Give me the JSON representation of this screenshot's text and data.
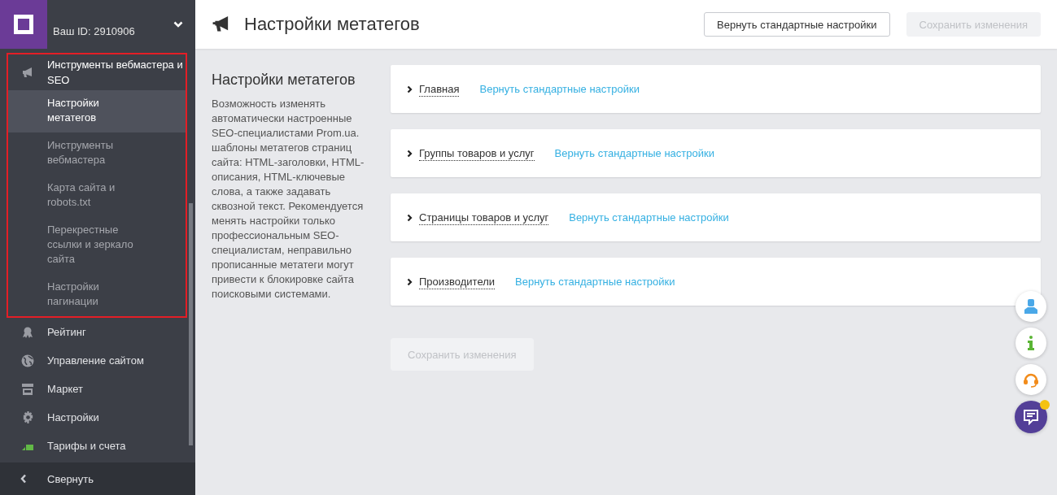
{
  "sidebar": {
    "account_id": "Ваш ID: 2910906",
    "menu": [
      {
        "label": "Инструменты вебмастера и SEO",
        "highlighted": true,
        "expanded": true,
        "children": [
          {
            "label": "Настройки метатегов",
            "selected": true
          },
          {
            "label": "Инструменты вебмастера",
            "selected": false
          },
          {
            "label": "Карта сайта и robots.txt",
            "selected": false
          },
          {
            "label": "Перекрестные ссылки и зеркало сайта",
            "selected": false
          },
          {
            "label": "Настройки пагинации",
            "selected": false
          }
        ]
      },
      {
        "label": "Рейтинг",
        "highlighted": false,
        "expanded": false
      },
      {
        "label": "Управление сайтом",
        "highlighted": false,
        "expanded": false
      },
      {
        "label": "Маркет",
        "highlighted": false,
        "expanded": false
      },
      {
        "label": "Настройки",
        "highlighted": false,
        "expanded": false
      },
      {
        "label": "Тарифы и счета",
        "highlighted": false,
        "expanded": false
      }
    ],
    "collapse": "Свернуть"
  },
  "header": {
    "title": "Настройки метатегов",
    "buttons": [
      {
        "label": "Вернуть стандартные настройки",
        "disabled": false
      },
      {
        "label": "Сохранить изменения",
        "disabled": true
      }
    ]
  },
  "info": {
    "title": "Настройки метатегов",
    "text": "Возможность изменять автоматически настроенные SEO-специалистами Prom.ua. шаблоны метатегов страниц сайта: HTML-заголовки, HTML-описания, HTML-ключевые слова, а также задавать сквозной текст. Рекомендуется менять настройки только профессиональным SEO-специалистам, неправильно прописанные метатеги могут привести к блокировке сайта поисковыми системами."
  },
  "sections": [
    {
      "label": "Главная",
      "link": "Вернуть стандартные настройки",
      "expanded": false
    },
    {
      "label": "Группы товаров и услуг",
      "link": "Вернуть стандартные настройки",
      "expanded": false
    },
    {
      "label": "Страницы товаров и услуг",
      "link": "Вернуть стандартные настройки",
      "expanded": false
    },
    {
      "label": "Производители",
      "link": "Вернуть стандартные настройки",
      "expanded": false
    }
  ],
  "save_button": {
    "label": "Сохранить изменения",
    "disabled": true
  },
  "floating_buttons": [
    {
      "notification": false
    },
    {
      "notification": false
    },
    {
      "notification": false
    },
    {
      "notification": true
    }
  ]
}
